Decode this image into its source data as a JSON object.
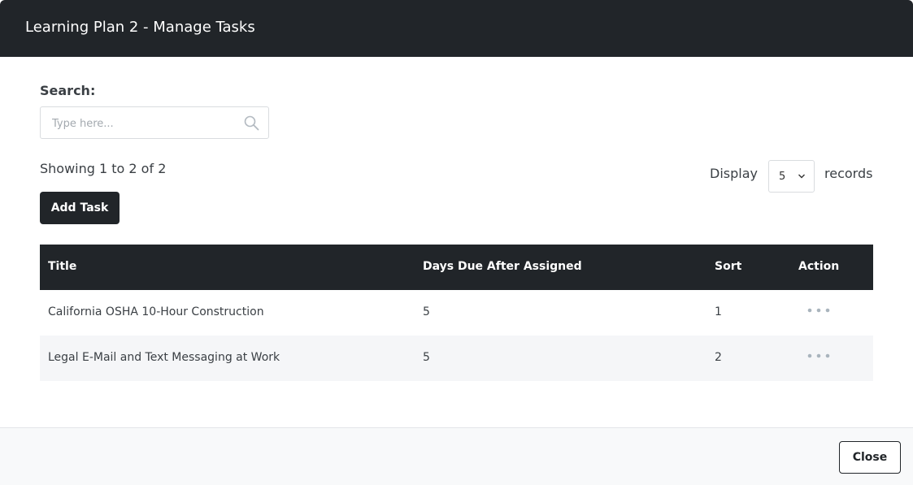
{
  "modal": {
    "title": "Learning Plan 2 - Manage Tasks"
  },
  "search": {
    "label": "Search:",
    "placeholder": "Type here...",
    "value": ""
  },
  "summary": {
    "showing": "Showing 1 to 2 of 2"
  },
  "pagination": {
    "display_label": "Display",
    "page_size": "5",
    "records_label": "records"
  },
  "toolbar": {
    "add_task_label": "Add Task"
  },
  "table": {
    "columns": [
      "Title",
      "Days Due After Assigned",
      "Sort",
      "Action"
    ],
    "rows": [
      {
        "title": "California OSHA 10-Hour Construction",
        "days_due": "5",
        "sort": "1"
      },
      {
        "title": "Legal E-Mail and Text Messaging at Work",
        "days_due": "5",
        "sort": "2"
      }
    ]
  },
  "footer": {
    "close_label": "Close"
  },
  "colors": {
    "header_bg": "#212529",
    "row_alt_bg": "#f5f6f8",
    "action_dots": "#a9b4bd"
  },
  "icons": {
    "search": "search-icon",
    "dropdown": "chevron-down-icon",
    "row_action": "more-horizontal-icon"
  }
}
